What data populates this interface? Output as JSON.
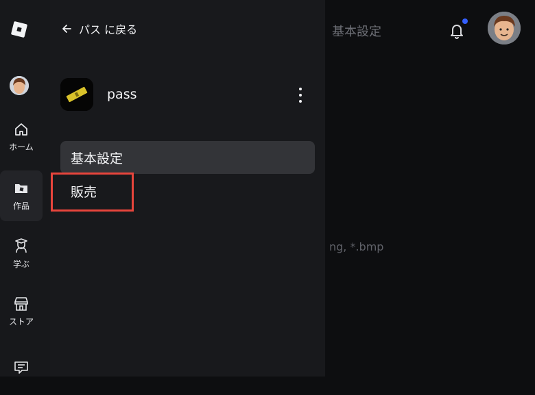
{
  "rail": {
    "items": [
      {
        "label": "ホーム",
        "icon": "home-icon"
      },
      {
        "label": "作品",
        "icon": "folder-icon"
      },
      {
        "label": "学ぶ",
        "icon": "graduation-icon"
      },
      {
        "label": "ストア",
        "icon": "store-icon"
      },
      {
        "label": "",
        "icon": "message-icon"
      }
    ]
  },
  "panel": {
    "back_label": "パス に戻る",
    "item_name": "pass",
    "nav": [
      {
        "label": "基本設定",
        "selected": true
      },
      {
        "label": "販売",
        "selected": false
      }
    ]
  },
  "main": {
    "title": "基本設定",
    "hint_text": "ng, *.bmp"
  },
  "colors": {
    "accent": "#335fff",
    "highlight": "#e8453c"
  }
}
